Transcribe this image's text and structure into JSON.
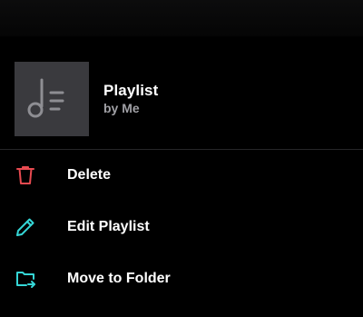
{
  "playlist": {
    "title": "Playlist",
    "owner": "by Me"
  },
  "menu": {
    "items": [
      {
        "label": "Delete",
        "icon": "trash-icon",
        "color": "#e84a50"
      },
      {
        "label": "Edit Playlist",
        "icon": "pencil-icon",
        "color": "#35d6d6"
      },
      {
        "label": "Move to Folder",
        "icon": "folder-move-icon",
        "color": "#35d6d6"
      }
    ]
  },
  "colors": {
    "background": "#000000",
    "artwork": "#3a3a3e",
    "artwork_glyph": "#8e8e93",
    "destructive": "#e84a50",
    "accent": "#35d6d6",
    "secondary_text": "#a0a0a5"
  }
}
